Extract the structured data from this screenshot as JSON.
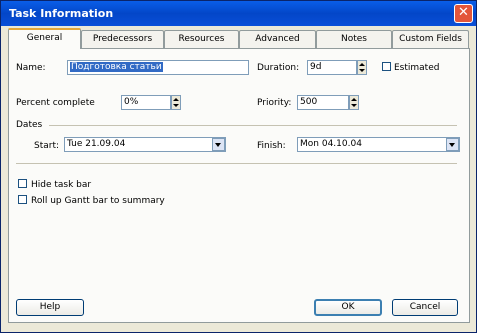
{
  "window": {
    "title": "Task Information",
    "close_icon": "✕"
  },
  "tabs": [
    {
      "label": "General",
      "active": true
    },
    {
      "label": "Predecessors"
    },
    {
      "label": "Resources"
    },
    {
      "label": "Advanced"
    },
    {
      "label": "Notes"
    },
    {
      "label": "Custom Fields"
    }
  ],
  "general": {
    "name_label": "Name:",
    "name_value": "Подготовка статьи",
    "duration_label": "Duration:",
    "duration_value": "9d",
    "estimated_label": "Estimated",
    "estimated_checked": false,
    "percent_label": "Percent complete",
    "percent_value": "0%",
    "priority_label": "Priority:",
    "priority_value": "500",
    "dates_group": "Dates",
    "start_label": "Start:",
    "start_value": "Tue 21.09.04",
    "finish_label": "Finish:",
    "finish_value": "Mon 04.10.04",
    "hide_taskbar_label": "Hide task bar",
    "hide_taskbar_checked": false,
    "rollup_label": "Roll up Gantt bar to summary",
    "rollup_checked": false
  },
  "buttons": {
    "help": "Help",
    "ok": "OK",
    "cancel": "Cancel"
  },
  "colors": {
    "title_bar": "#0346c8",
    "selection": "#316ac5",
    "close": "#e3563a"
  }
}
